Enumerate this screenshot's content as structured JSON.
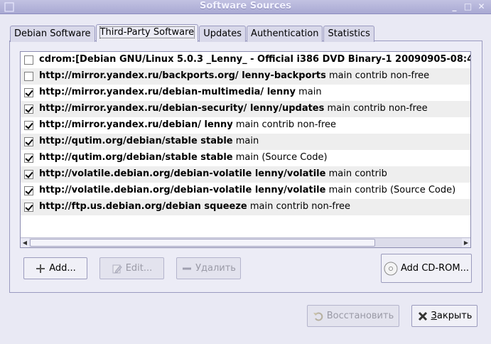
{
  "window": {
    "title": "Software Sources"
  },
  "tabs": [
    {
      "label": "Debian Software",
      "active": false
    },
    {
      "label": "Third-Party Software",
      "active": true
    },
    {
      "label": "Updates",
      "active": false
    },
    {
      "label": "Authentication",
      "active": false
    },
    {
      "label": "Statistics",
      "active": false
    }
  ],
  "sources": [
    {
      "checked": false,
      "bold": "cdrom:[Debian GNU/Linux 5.0.3 _Lenny_ - Official i386 DVD Binary-1 20090905-08:4",
      "rest": ""
    },
    {
      "checked": false,
      "bold": "http://mirror.yandex.ru/backports.org/ lenny-backports",
      "rest": " main contrib non-free"
    },
    {
      "checked": true,
      "bold": "http://mirror.yandex.ru/debian-multimedia/ lenny",
      "rest": " main"
    },
    {
      "checked": true,
      "bold": "http://mirror.yandex.ru/debian-security/ lenny/updates",
      "rest": " main contrib non-free"
    },
    {
      "checked": true,
      "bold": "http://mirror.yandex.ru/debian/ lenny",
      "rest": " main contrib non-free"
    },
    {
      "checked": true,
      "bold": "http://qutim.org/debian/stable stable",
      "rest": " main"
    },
    {
      "checked": true,
      "bold": "http://qutim.org/debian/stable stable",
      "rest": " main (Source Code)"
    },
    {
      "checked": true,
      "bold": "http://volatile.debian.org/debian-volatile lenny/volatile",
      "rest": " main contrib"
    },
    {
      "checked": true,
      "bold": "http://volatile.debian.org/debian-volatile lenny/volatile",
      "rest": " main contrib (Source Code)"
    },
    {
      "checked": true,
      "bold": "http://ftp.us.debian.org/debian squeeze",
      "rest": " main contrib non-free"
    }
  ],
  "buttons": {
    "add": "Add...",
    "edit": "Edit...",
    "remove": "Удалить",
    "add_cdrom": "Add CD-ROM...",
    "revert": "Восстановить",
    "close_prefix": "",
    "close_mnemonic": "З",
    "close_rest": "акрыть"
  },
  "colors": {
    "window_bg": "#e9e9f4",
    "titlebar": "#b0b0d8",
    "row_alt": "#eeeeee"
  },
  "icons": {
    "add": "plus-icon",
    "edit": "edit-icon",
    "remove": "minus-icon",
    "cdrom": "cdrom-icon",
    "revert": "revert-icon",
    "close": "close-x-icon"
  }
}
